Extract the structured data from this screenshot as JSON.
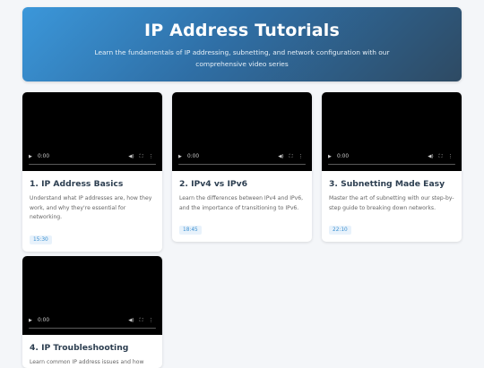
{
  "header": {
    "title": "IP Address Tutorials",
    "subtitle": "Learn the fundamentals of IP addressing, subnetting, and network configuration with our comprehensive video series"
  },
  "videos": [
    {
      "title": "1. IP Address Basics",
      "description": "Understand what IP addresses are, how they work, and why they're essential for networking.",
      "duration": "15:30",
      "player_time": "0:00"
    },
    {
      "title": "2. IPv4 vs IPv6",
      "description": "Learn the differences between IPv4 and IPv6, and the importance of transitioning to IPv6.",
      "duration": "18:45",
      "player_time": "0:00"
    },
    {
      "title": "3. Subnetting Made Easy",
      "description": "Master the art of subnetting with our step-by-step guide to breaking down networks.",
      "duration": "22:10",
      "player_time": "0:00"
    },
    {
      "title": "4. IP Troubleshooting",
      "description": "Learn common IP address issues and how",
      "duration": "",
      "player_time": "0:00"
    }
  ]
}
